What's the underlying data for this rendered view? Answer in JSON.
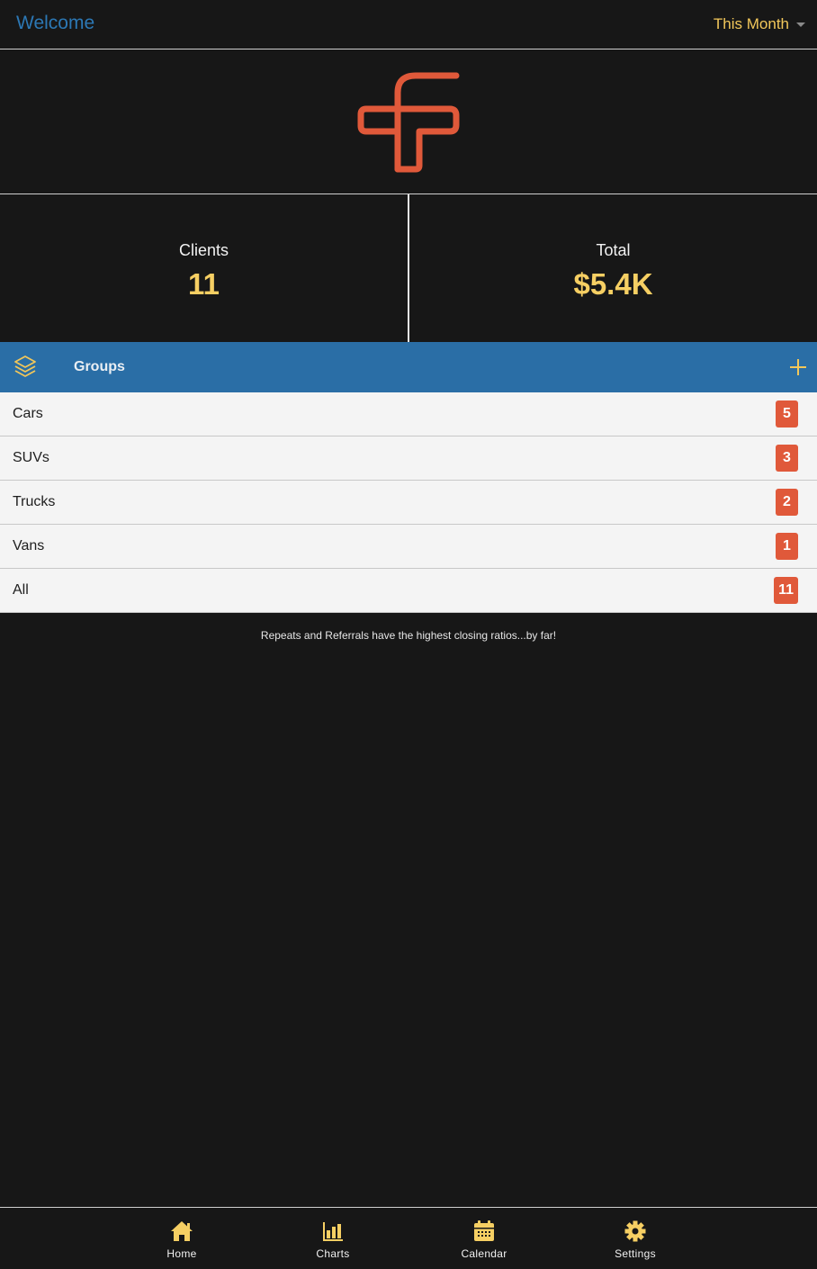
{
  "header": {
    "title": "Welcome",
    "period": "This Month"
  },
  "logo": {
    "icon": "app-logo"
  },
  "stats": {
    "clients_label": "Clients",
    "clients_value": "11",
    "total_label": "Total",
    "total_value": "$5.4K"
  },
  "groups": {
    "title": "Groups",
    "items": [
      {
        "label": "Cars",
        "count": "5"
      },
      {
        "label": "SUVs",
        "count": "3"
      },
      {
        "label": "Trucks",
        "count": "2"
      },
      {
        "label": "Vans",
        "count": "1"
      },
      {
        "label": "All",
        "count": "11"
      }
    ]
  },
  "tip": "Repeats and Referrals have the highest closing ratios...by far!",
  "tabs": [
    {
      "label": "Home",
      "icon": "home-icon"
    },
    {
      "label": "Charts",
      "icon": "bar-chart-icon"
    },
    {
      "label": "Calendar",
      "icon": "calendar-icon"
    },
    {
      "label": "Settings",
      "icon": "gear-icon"
    }
  ],
  "colors": {
    "accent_blue": "#2a6ea6",
    "accent_yellow": "#f6cf63",
    "badge_orange": "#e0593a",
    "background": "#171717"
  }
}
